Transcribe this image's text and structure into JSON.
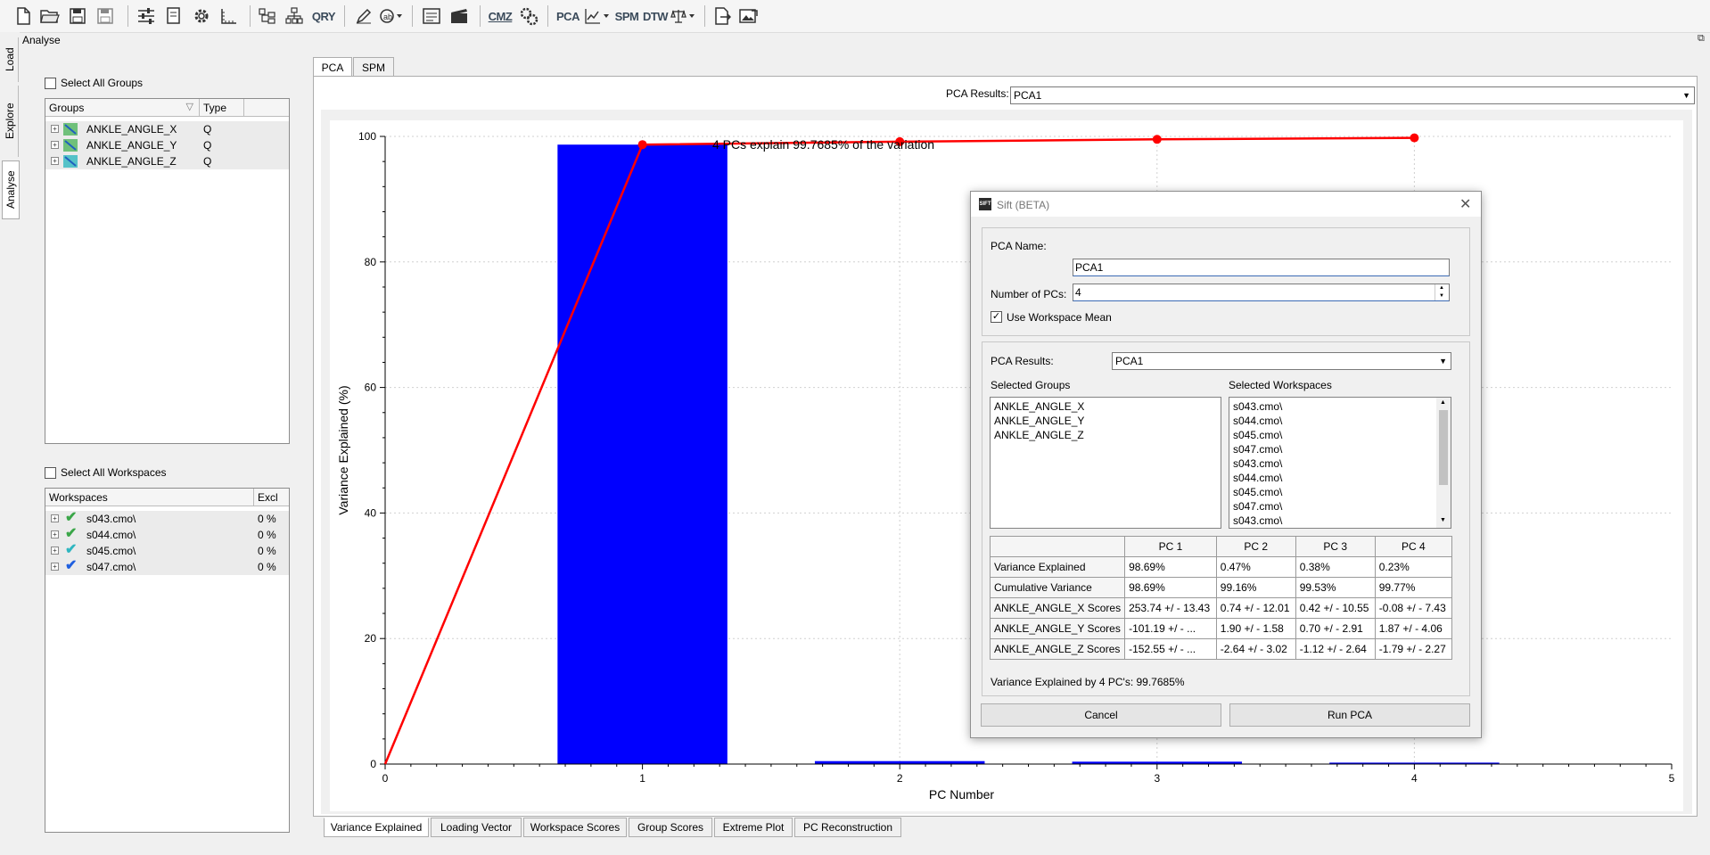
{
  "toolbar": {
    "icons": [
      "new-file-icon",
      "open-folder-icon",
      "save-icon",
      "save-as-icon",
      "settings-sliders-icon",
      "edit-document-icon",
      "gear-icon",
      "ruler-icon",
      "group-layout-icon",
      "tree-icon",
      "query-icon",
      "pen-icon",
      "palette-icon",
      "report-icon",
      "movie-icon",
      "cmz-icon",
      "gears-icon"
    ],
    "text_buttons": {
      "qry": "QRY",
      "cmz": "CMZ",
      "pca": "PCA",
      "spm": "SPM",
      "dtw": "DTW"
    }
  },
  "side_tabs": [
    "Load",
    "Explore",
    "Analyse"
  ],
  "window_title": "Analyse",
  "left_panel": {
    "select_all_groups": "Select All Groups",
    "groups_header": {
      "groups": "Groups",
      "type": "Type"
    },
    "groups": [
      {
        "name": "ANKLE_ANGLE_X",
        "type": "Q"
      },
      {
        "name": "ANKLE_ANGLE_Y",
        "type": "Q"
      },
      {
        "name": "ANKLE_ANGLE_Z",
        "type": "Q"
      }
    ],
    "select_all_workspaces": "Select All Workspaces",
    "workspaces_header": {
      "workspaces": "Workspaces",
      "excl": "Excl"
    },
    "workspaces": [
      {
        "name": "s043.cmo\\",
        "excl": "0 %"
      },
      {
        "name": "s044.cmo\\",
        "excl": "0 %"
      },
      {
        "name": "s045.cmo\\",
        "excl": "0 %"
      },
      {
        "name": "s047.cmo\\",
        "excl": "0 %"
      }
    ]
  },
  "top_tabs": [
    "PCA",
    "SPM"
  ],
  "pca_results_label": "PCA Results:",
  "pca_results_value": "PCA1",
  "bottom_tabs": [
    "Variance Explained",
    "Loading Vector",
    "Workspace Scores",
    "Group Scores",
    "Extreme Plot",
    "PC Reconstruction"
  ],
  "chart_data": {
    "type": "bar",
    "title": "4 PCs explain 99.7685% of the variation",
    "xlabel": "PC Number",
    "ylabel": "Variance Explained (%)",
    "xlim": [
      0,
      5
    ],
    "ylim": [
      0,
      100
    ],
    "x_ticks": [
      "0",
      "1",
      "2",
      "3",
      "4",
      "5"
    ],
    "y_ticks": [
      "0",
      "20",
      "40",
      "60",
      "80",
      "100"
    ],
    "grid": true,
    "bar_color": "#0000ff",
    "line_color": "#ff0000",
    "bars": [
      {
        "x": 1,
        "value": 98.69
      },
      {
        "x": 2,
        "value": 0.47
      },
      {
        "x": 3,
        "value": 0.38
      },
      {
        "x": 4,
        "value": 0.23
      }
    ],
    "cumulative_line": [
      {
        "x": 0,
        "value": 0
      },
      {
        "x": 1,
        "value": 98.69
      },
      {
        "x": 2,
        "value": 99.16
      },
      {
        "x": 3,
        "value": 99.53
      },
      {
        "x": 4,
        "value": 99.77
      }
    ]
  },
  "dialog": {
    "title": "Sift (BETA)",
    "app_icon_text": "SIFT",
    "pca_name_label": "PCA Name:",
    "pca_name_value": "PCA1",
    "num_pcs_label": "Number of PCs:",
    "num_pcs_value": "4",
    "use_workspace_mean_label": "Use Workspace Mean",
    "use_workspace_mean_checked": true,
    "pca_results_label": "PCA Results:",
    "pca_results_value": "PCA1",
    "selected_groups_label": "Selected Groups",
    "selected_groups": [
      "ANKLE_ANGLE_X",
      "ANKLE_ANGLE_Y",
      "ANKLE_ANGLE_Z"
    ],
    "selected_workspaces_label": "Selected Workspaces",
    "selected_workspaces": [
      "s043.cmo\\",
      "s044.cmo\\",
      "s045.cmo\\",
      "s047.cmo\\",
      "s043.cmo\\",
      "s044.cmo\\",
      "s045.cmo\\",
      "s047.cmo\\",
      "s043.cmo\\"
    ],
    "table": {
      "columns": [
        "PC 1",
        "PC 2",
        "PC 3",
        "PC 4"
      ],
      "rows": [
        {
          "label": "Variance Explained",
          "cells": [
            "98.69%",
            "0.47%",
            "0.38%",
            "0.23%"
          ]
        },
        {
          "label": "Cumulative Variance",
          "cells": [
            "98.69%",
            "99.16%",
            "99.53%",
            "99.77%"
          ]
        },
        {
          "label": "ANKLE_ANGLE_X Scores",
          "cells": [
            "253.74 +/ - 13.43",
            "0.74 +/ - 12.01",
            "0.42 +/ - 10.55",
            "-0.08 +/ - 7.43"
          ]
        },
        {
          "label": "ANKLE_ANGLE_Y Scores",
          "cells": [
            "-101.19 +/ - ...",
            "1.90 +/ - 1.58",
            "0.70 +/ - 2.91",
            "1.87 +/ - 4.06"
          ]
        },
        {
          "label": "ANKLE_ANGLE_Z Scores",
          "cells": [
            "-152.55 +/ - ...",
            "-2.64 +/ - 3.02",
            "-1.12 +/ - 2.64",
            "-1.79 +/ - 2.27"
          ]
        }
      ]
    },
    "variance_summary": "Variance Explained by 4 PC's:  99.7685%",
    "cancel_label": "Cancel",
    "run_label": "Run PCA"
  }
}
